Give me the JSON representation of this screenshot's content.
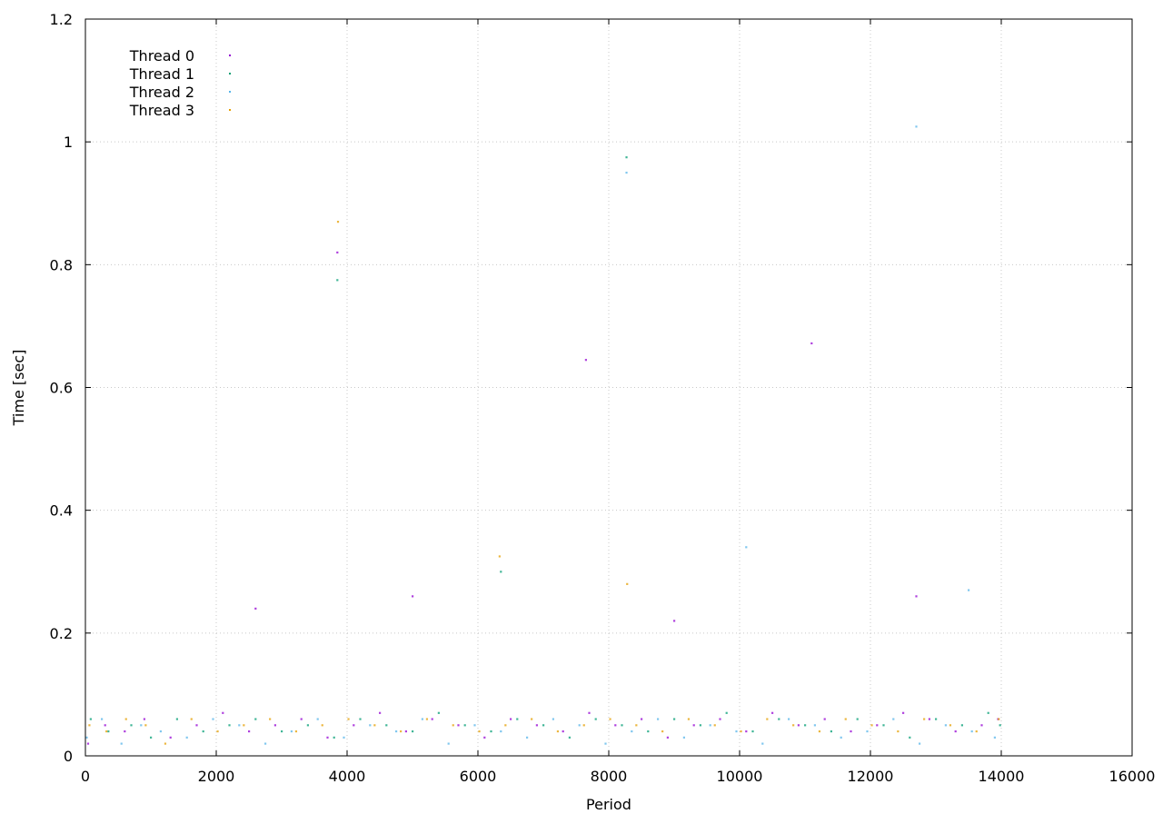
{
  "chart_data": {
    "type": "scatter",
    "title": "",
    "xlabel": "Period",
    "ylabel": "Time [sec]",
    "xlim": [
      0,
      16000
    ],
    "ylim": [
      0,
      1.2
    ],
    "xticks": [
      0,
      2000,
      4000,
      6000,
      8000,
      10000,
      12000,
      14000,
      16000
    ],
    "yticks": [
      0,
      0.2,
      0.4,
      0.6,
      0.8,
      1,
      1.2
    ],
    "xtick_labels": [
      "0",
      "2000",
      "4000",
      "6000",
      "8000",
      "10000",
      "12000",
      "14000",
      "16000"
    ],
    "ytick_labels": [
      "0",
      "0.2",
      "0.4",
      "0.6",
      "0.8",
      "1",
      "1.2"
    ],
    "grid": true,
    "legend_position": "top-left",
    "series": [
      {
        "name": "Thread 0",
        "color": "#9400d3",
        "x": [
          40,
          300,
          600,
          900,
          1300,
          1700,
          2100,
          2500,
          2900,
          3300,
          3700,
          4100,
          4500,
          4900,
          5300,
          5700,
          6100,
          6500,
          6900,
          7300,
          7700,
          8100,
          8500,
          8900,
          9300,
          9700,
          10100,
          10500,
          10900,
          11300,
          11700,
          12100,
          12500,
          12900,
          13300,
          13700,
          13950,
          3850,
          7650,
          11100,
          2600,
          5000,
          9000,
          12700
        ],
        "y": [
          0.02,
          0.05,
          0.04,
          0.06,
          0.03,
          0.05,
          0.07,
          0.04,
          0.05,
          0.06,
          0.03,
          0.05,
          0.07,
          0.04,
          0.06,
          0.05,
          0.03,
          0.06,
          0.05,
          0.04,
          0.07,
          0.05,
          0.06,
          0.03,
          0.05,
          0.06,
          0.04,
          0.07,
          0.05,
          0.06,
          0.04,
          0.05,
          0.07,
          0.06,
          0.04,
          0.05,
          0.06,
          0.82,
          0.645,
          0.672,
          0.24,
          0.26,
          0.22,
          0.26
        ]
      },
      {
        "name": "Thread 1",
        "color": "#009e73",
        "x": [
          80,
          350,
          700,
          1000,
          1400,
          1800,
          2200,
          2600,
          3000,
          3400,
          3800,
          4200,
          4600,
          5000,
          5400,
          5800,
          6200,
          6600,
          7000,
          7400,
          7800,
          8200,
          8600,
          9000,
          9400,
          9800,
          10200,
          10600,
          11000,
          11400,
          11800,
          12200,
          12600,
          13000,
          13400,
          13800,
          13980,
          3850,
          8270,
          6350
        ],
        "y": [
          0.06,
          0.04,
          0.05,
          0.03,
          0.06,
          0.04,
          0.05,
          0.06,
          0.04,
          0.05,
          0.03,
          0.06,
          0.05,
          0.04,
          0.07,
          0.05,
          0.04,
          0.06,
          0.05,
          0.03,
          0.06,
          0.05,
          0.04,
          0.06,
          0.05,
          0.07,
          0.04,
          0.06,
          0.05,
          0.04,
          0.06,
          0.05,
          0.03,
          0.06,
          0.05,
          0.07,
          0.05,
          0.775,
          0.975,
          0.3
        ]
      },
      {
        "name": "Thread 2",
        "color": "#56b4e9",
        "x": [
          20,
          250,
          550,
          850,
          1150,
          1550,
          1950,
          2350,
          2750,
          3150,
          3550,
          3950,
          4350,
          4750,
          5150,
          5550,
          5950,
          6350,
          6750,
          7150,
          7550,
          7950,
          8350,
          8750,
          9150,
          9550,
          9950,
          10350,
          10750,
          11150,
          11550,
          11950,
          12350,
          12750,
          13150,
          13550,
          13900,
          12700,
          8270,
          10100,
          13500
        ],
        "y": [
          0.03,
          0.06,
          0.02,
          0.05,
          0.04,
          0.03,
          0.06,
          0.05,
          0.02,
          0.04,
          0.06,
          0.03,
          0.05,
          0.04,
          0.06,
          0.02,
          0.05,
          0.04,
          0.03,
          0.06,
          0.05,
          0.02,
          0.04,
          0.06,
          0.03,
          0.05,
          0.04,
          0.02,
          0.06,
          0.05,
          0.03,
          0.04,
          0.06,
          0.02,
          0.05,
          0.04,
          0.03,
          1.025,
          0.95,
          0.34,
          0.27
        ]
      },
      {
        "name": "Thread 3",
        "color": "#e69f00",
        "x": [
          60,
          320,
          620,
          920,
          1220,
          1620,
          2020,
          2420,
          2820,
          3220,
          3620,
          4020,
          4420,
          4820,
          5220,
          5620,
          6020,
          6420,
          6820,
          7220,
          7620,
          8020,
          8420,
          8820,
          9220,
          9620,
          10020,
          10420,
          10820,
          11220,
          11620,
          12020,
          12420,
          12820,
          13220,
          13620,
          13960,
          3860,
          6330,
          8280
        ],
        "y": [
          0.05,
          0.04,
          0.06,
          0.05,
          0.02,
          0.06,
          0.04,
          0.05,
          0.06,
          0.04,
          0.05,
          0.06,
          0.05,
          0.04,
          0.06,
          0.05,
          0.04,
          0.05,
          0.06,
          0.04,
          0.05,
          0.06,
          0.05,
          0.04,
          0.06,
          0.05,
          0.04,
          0.06,
          0.05,
          0.04,
          0.06,
          0.05,
          0.04,
          0.06,
          0.05,
          0.04,
          0.06,
          0.87,
          0.325,
          0.28
        ]
      }
    ]
  }
}
